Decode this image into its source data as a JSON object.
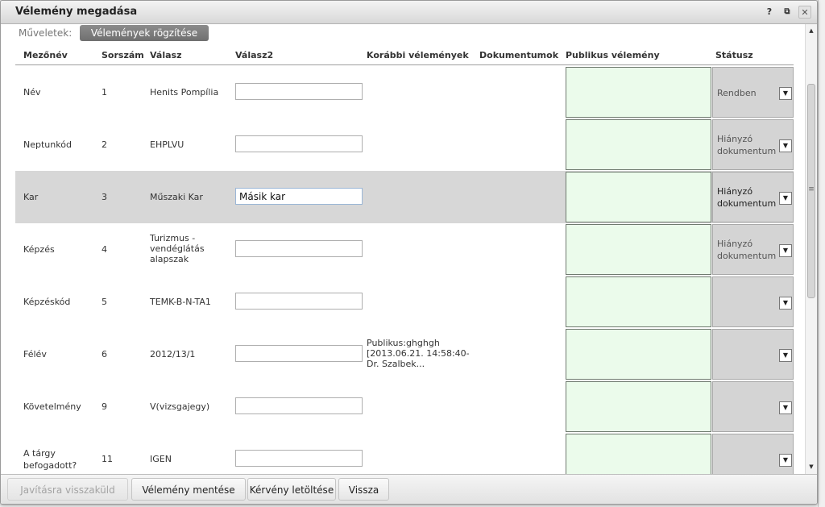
{
  "dialog": {
    "title": "Vélemény megadása",
    "help_glyph": "?",
    "popout_glyph": "⧉",
    "close_glyph": "✕"
  },
  "operations": {
    "label": "Műveletek:",
    "record_opinions_button": "Vélemények rögzítése"
  },
  "table": {
    "headers": {
      "field_name": "Mezőnév",
      "serial": "Sorszám",
      "answer": "Válasz",
      "answer2": "Válasz2",
      "previous_opinions": "Korábbi vélemények",
      "documents": "Dokumentumok",
      "public_opinion": "Publikus vélemény",
      "status": "Státusz"
    },
    "rows": [
      {
        "field": "Név",
        "num": "1",
        "answer": "Henits Pompília",
        "answer2": "",
        "previous": "",
        "status": "Rendben",
        "selected": false
      },
      {
        "field": "Neptunkód",
        "num": "2",
        "answer": "EHPLVU",
        "answer2": "",
        "previous": "",
        "status": "Hiányzó dokumentum",
        "selected": false
      },
      {
        "field": "Kar",
        "num": "3",
        "answer": "Műszaki Kar",
        "answer2": "Másik kar",
        "previous": "",
        "status": "Hiányzó dokumentum",
        "selected": true
      },
      {
        "field": "Képzés",
        "num": "4",
        "answer": "Turizmus - vendéglátás alapszak",
        "answer2": "",
        "previous": "",
        "status": "Hiányzó dokumentum",
        "selected": false
      },
      {
        "field": "Képzéskód",
        "num": "5",
        "answer": "TEMK-B-N-TA1",
        "answer2": "",
        "previous": "",
        "status": "",
        "selected": false
      },
      {
        "field": "Félév",
        "num": "6",
        "answer": "2012/13/1",
        "answer2": "",
        "previous": "Publikus:ghghgh [2013.06.21. 14:58:40-Dr. Szalbek...",
        "status": "",
        "selected": false
      },
      {
        "field": "Követelmény",
        "num": "9",
        "answer": "V(vizsgajegy)",
        "answer2": "",
        "previous": "",
        "status": "",
        "selected": false
      },
      {
        "field": "A tárgy befogadott?",
        "num": "11",
        "answer": "IGEN",
        "answer2": "",
        "previous": "",
        "status": "",
        "selected": false
      }
    ],
    "dropdown_glyph": "▼"
  },
  "footer": {
    "return_for_correction": "Javításra visszaküld",
    "save_opinion": "Vélemény mentése",
    "download_request": "Kérvény letöltése",
    "back": "Vissza"
  }
}
